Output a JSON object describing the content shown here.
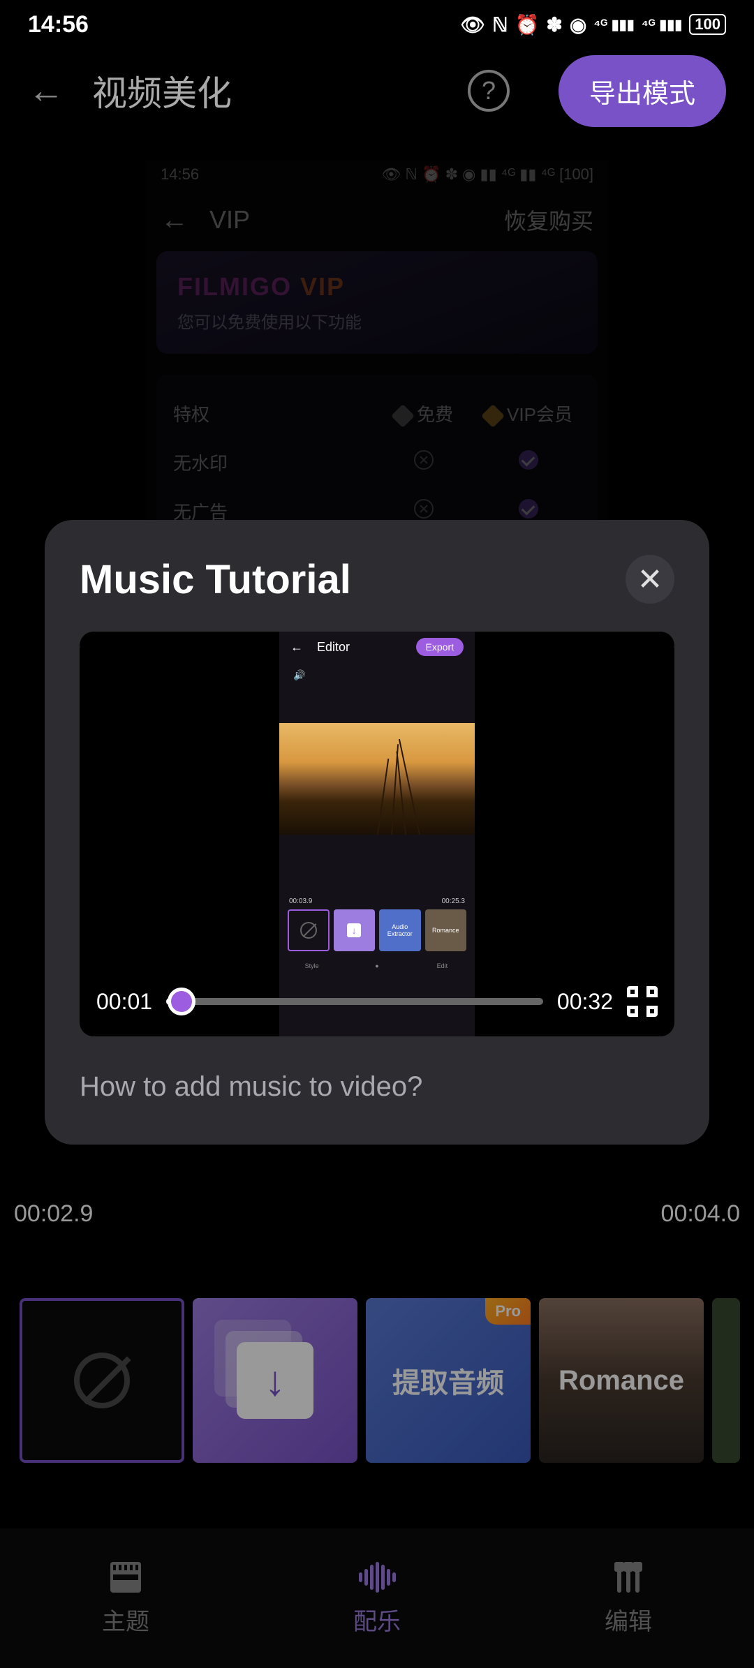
{
  "status": {
    "time": "14:56",
    "battery": "100"
  },
  "header": {
    "title": "视频美化",
    "export_label": "导出模式"
  },
  "bg_vip": {
    "status_time": "14:56",
    "title": "VIP",
    "restore": "恢复购买",
    "brand1": "FILMIGO",
    "brand2": "VIP",
    "subtitle": "您可以免费使用以下功能",
    "col_feature": "特权",
    "col_free": "免费",
    "col_vip": "VIP会员",
    "row1": "无水印",
    "row2": "无广告"
  },
  "editor": {
    "t_left": "00:02.9",
    "t_right": "00:04.0"
  },
  "tiles": {
    "extract": "提取音频",
    "pro": "Pro",
    "romance": "Romance"
  },
  "nav": {
    "theme": "主题",
    "music": "配乐",
    "edit": "编辑"
  },
  "modal": {
    "title": "Music Tutorial",
    "caption": "How to add music to video?",
    "current": "00:01",
    "duration": "00:32",
    "progress_pct": 4
  },
  "tutorial_video": {
    "editor_label": "Editor",
    "export_label": "Export",
    "t_left": "00:03.9",
    "t_right": "00:25.3",
    "thumb_extract": "Audio Extractor",
    "thumb_romance": "Romance",
    "nav_style": "Style",
    "nav_edit": "Edit"
  }
}
